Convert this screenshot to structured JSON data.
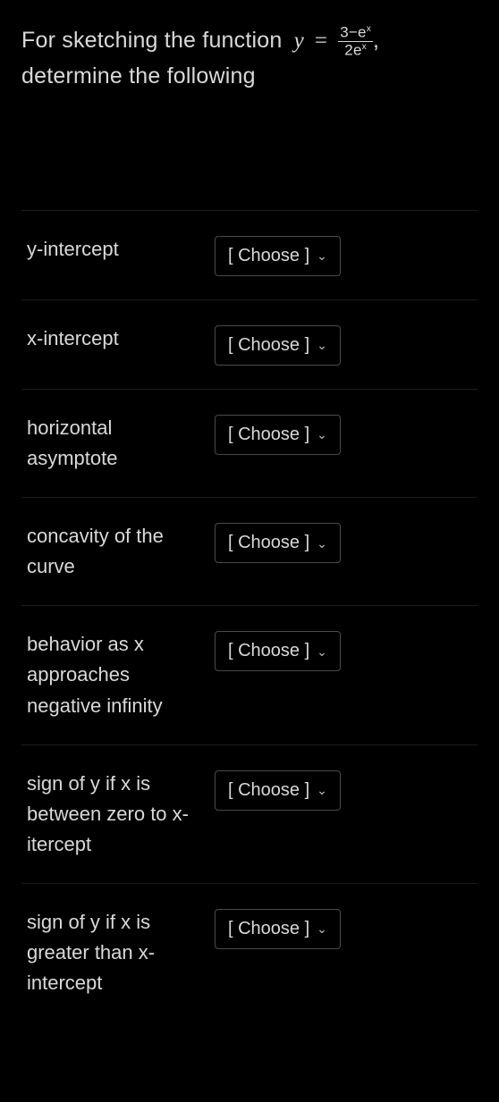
{
  "prompt": {
    "pre": "For sketching the function ",
    "var": "y",
    "eq": "=",
    "num_pre": "3−",
    "num_e": "e",
    "num_exp": "x",
    "den_two": "2",
    "den_e": "e",
    "den_exp": "x",
    "post_comma": ",",
    "line2": "determine the following"
  },
  "choose_label": "[ Choose ]",
  "rows": [
    {
      "label": "y-intercept"
    },
    {
      "label": "x-intercept"
    },
    {
      "label": "horizontal asymptote"
    },
    {
      "label": "concavity of the curve"
    },
    {
      "label": "behavior as x approaches negative infinity"
    },
    {
      "label": "sign of y if x is between zero to x-itercept"
    },
    {
      "label": "sign of y if x is greater than x-intercept"
    }
  ]
}
